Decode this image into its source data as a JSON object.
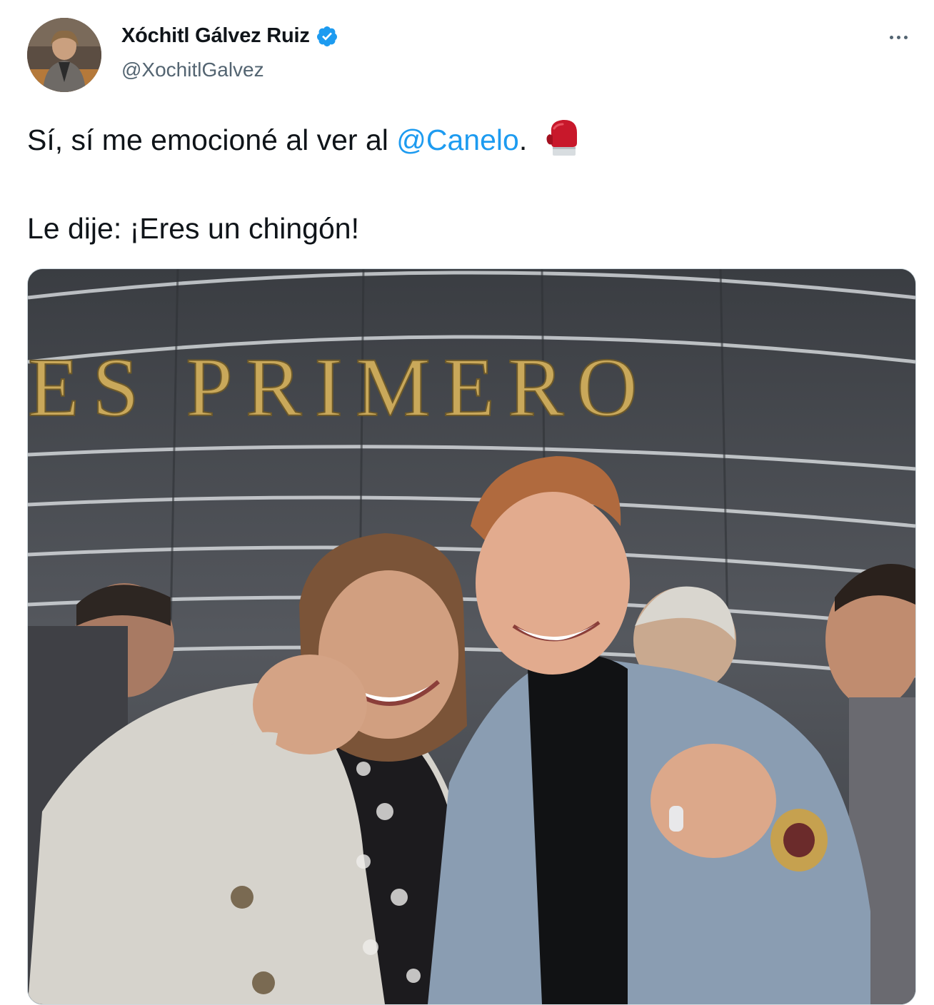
{
  "author": {
    "name": "Xóchitl Gálvez Ruiz",
    "handle": "@XochitlGalvez",
    "verified": true
  },
  "tweet": {
    "line1_before": "Sí, sí me emocioné al ver al ",
    "mention": "@Canelo",
    "line1_after": ".",
    "line2": "Le dije: ¡Eres un chingón!",
    "emoji": "boxing-glove-icon"
  },
  "media": {
    "wall_text": "ES PRIMERO"
  },
  "colors": {
    "link": "#1d9bf0",
    "verified": "#1d9bf0",
    "secondary_text": "#536471",
    "wall_letters": "#c9a85a"
  }
}
